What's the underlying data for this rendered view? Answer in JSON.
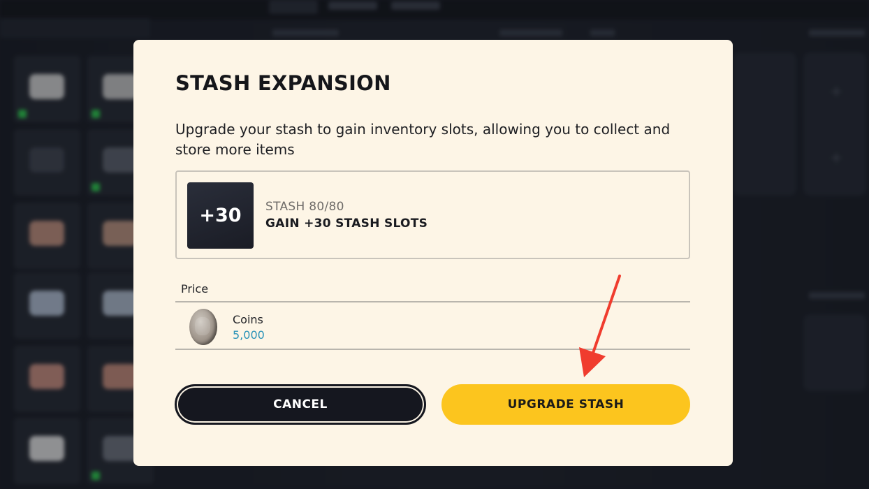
{
  "modal": {
    "title": "STASH EXPANSION",
    "description": "Upgrade your stash to gain inventory slots, allowing you to collect and store more items",
    "upgrade": {
      "tile_text": "+30",
      "stash_count": "STASH 80/80",
      "gain_text": "GAIN +30 STASH SLOTS"
    },
    "price": {
      "label": "Price",
      "currency_name": "Coins",
      "amount": "5,000"
    },
    "buttons": {
      "cancel": "CANCEL",
      "upgrade": "UPGRADE STASH"
    }
  },
  "colors": {
    "modal_background": "#fdf5e6",
    "primary_button": "#fcc51e",
    "secondary_button": "#15171f",
    "amount_accent": "#2a93b8",
    "annotation_arrow": "#f03c2e"
  },
  "icons": {
    "currency": "coin-icon",
    "annotation": "red-arrow-icon"
  }
}
